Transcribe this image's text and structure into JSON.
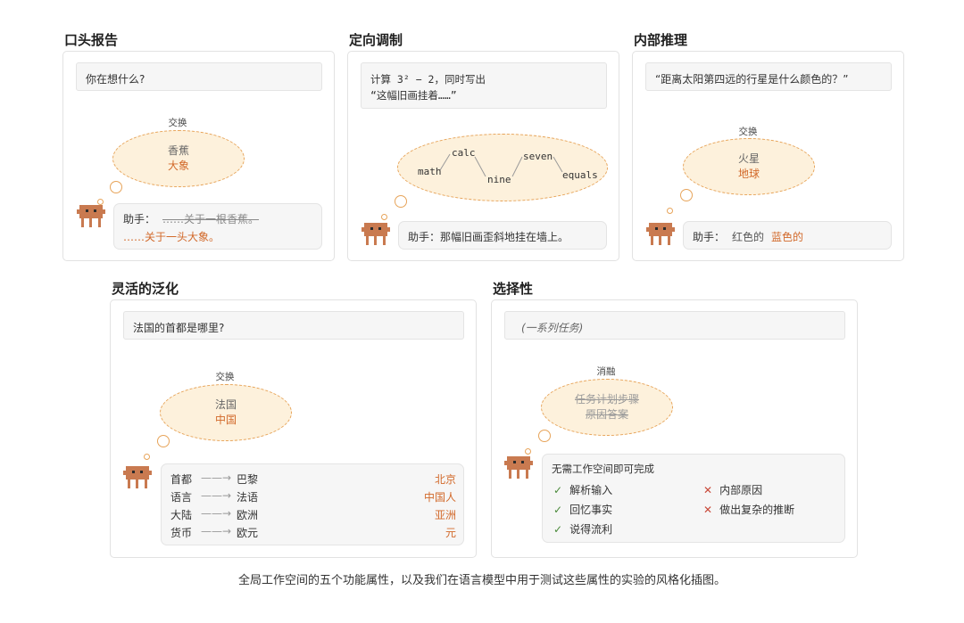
{
  "panels": {
    "oral": {
      "title": "口头报告",
      "prompt": "你在想什么?",
      "op_label": "交换",
      "bubble_old": "香蕉",
      "bubble_new": "大象",
      "answer_prefix": "助手：",
      "answer_strike": "……关于一根香蕉。",
      "answer_new": "……关于一头大象。"
    },
    "steering": {
      "title": "定向调制",
      "prompt_line1": "计算 3² − 2，同时写出",
      "prompt_line2": "“这幅旧画挂着……”",
      "tokens": [
        "math",
        "calc",
        "nine",
        "seven",
        "equals"
      ],
      "answer_prefix": "助手：",
      "answer_text": "那幅旧画歪斜地挂在墙上。"
    },
    "internal": {
      "title": "内部推理",
      "prompt": "“距离太阳第四远的行星是什么颜色的？”",
      "op_label": "交换",
      "bubble_old": "火星",
      "bubble_new": "地球",
      "answer_prefix": "助手：",
      "answer_old": "红色的",
      "answer_new": "蓝色的"
    },
    "flexible": {
      "title": "灵活的泛化",
      "prompt": "法国的首都是哪里?",
      "op_label": "交换",
      "bubble_old": "法国",
      "bubble_new": "中国",
      "rows": [
        {
          "key": "首都",
          "val": "巴黎",
          "new": "北京"
        },
        {
          "key": "语言",
          "val": "法语",
          "new": "中国人"
        },
        {
          "key": "大陆",
          "val": "欧洲",
          "new": "亚洲"
        },
        {
          "key": "货币",
          "val": "欧元",
          "new": "元"
        }
      ]
    },
    "selective": {
      "title": "选择性",
      "prompt": "(一系列任务)",
      "op_label": "消融",
      "bubble_line1": "任务计划步骤",
      "bubble_line2": "原因答案",
      "box_title": "无需工作空间即可完成",
      "checks": [
        "解析输入",
        "回忆事实",
        "说得流利"
      ],
      "crosses": [
        "内部原因",
        "做出复杂的推断"
      ]
    }
  },
  "caption": "全局工作空间的五个功能属性，以及我们在语言模型中用于测试这些属性的实验的风格化插图。"
}
